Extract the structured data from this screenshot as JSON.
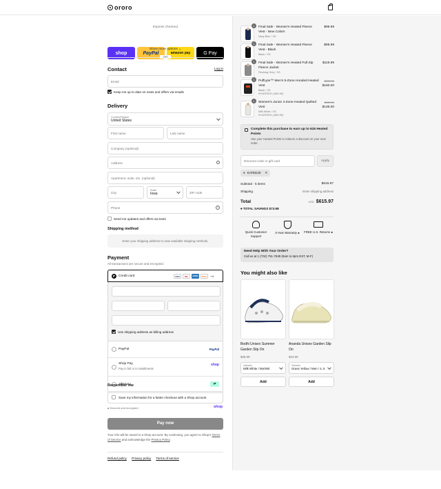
{
  "header": {
    "logo": "ororo",
    "cart_icon": "shopping-bag-icon"
  },
  "express": {
    "title": "Express checkout",
    "buttons": [
      {
        "label": "shop",
        "color": "#5a31f4",
        "text_color": "#ffffff"
      },
      {
        "label": "PayPal",
        "color": "#ffc439",
        "text_color": "#003087"
      },
      {
        "label": "amazon pay",
        "color": "#ffd814",
        "text_color": "#111111"
      },
      {
        "label": "G Pay",
        "color": "#000000",
        "text_color": "#ffffff"
      }
    ],
    "more": "Show more options",
    "or": "OR"
  },
  "contact": {
    "title": "Contact",
    "login": "Log in",
    "email_placeholder": "Email",
    "news_label": "Keep me up to date on news and offers via emails"
  },
  "delivery": {
    "title": "Delivery",
    "country_label": "Country/Region",
    "country_value": "United States",
    "first_name": "First name",
    "last_name": "Last name",
    "company": "Company (optional)",
    "address": "Address",
    "apartment": "Apartment, suite, etc. (optional)",
    "city": "City",
    "state_label": "State",
    "state_value": "Iowa",
    "zip": "ZIP code",
    "phone": "Phone",
    "sms_label": "Send me updates and offers via texts"
  },
  "shipping_method": {
    "title": "Shipping method",
    "note": "Enter your shipping address to view available shipping methods."
  },
  "payment": {
    "title": "Payment",
    "subtitle": "All transactions are secure and encrypted.",
    "credit_card": "Credit card",
    "card_brands": [
      "VISA",
      "MC",
      "AMEX",
      "DISC"
    ],
    "more_cards": "+4",
    "billing_label": "Use shipping address as billing address",
    "paypal": "PayPal",
    "paypal_logo": "PayPal",
    "shoppay": "Shop Pay",
    "shoppay_sub": "Pay in full or in installments",
    "shoppay_logo": "shop",
    "afterpay": "Afterpay"
  },
  "remember": {
    "title": "Remember me",
    "label": "Save my information for a faster checkout with a Shop account",
    "secure": "Secured and encrypted",
    "shop": "shop"
  },
  "pay_now": "Pay now",
  "legal": {
    "text_1": "Your info will be saved to a Shop account. By continuing, you agree to Shop's",
    "terms": "Terms of Service",
    "text_2": "and acknowledge the",
    "privacy": "Privacy Policy",
    "text_3": "."
  },
  "footer_links": [
    "Refund policy",
    "Privacy policy",
    "Terms of service"
  ],
  "cart": {
    "items": [
      {
        "qty": "1",
        "name": "Final Sale - Women's Heated Fleece Vest - New Colors",
        "variant": "Navy Blue / XS",
        "price": "$99.99",
        "tag": ""
      },
      {
        "qty": "1",
        "name": "Final Sale - Women's Heated Fleece Vest - Black",
        "variant": "Black / XS",
        "price": "$99.99",
        "tag": ""
      },
      {
        "qty": "1",
        "name": "Final Sale - Women's Heated Full-Zip Fleece Jacket",
        "variant": "Flecking Grey / XS",
        "price": "$119.99",
        "tag": ""
      },
      {
        "qty": "1",
        "name": "PuffLyte™ Men's 5-Zone Hooded Heated Vest",
        "variant": "Black / XS",
        "old_price": "$199.99",
        "price": "$160.00",
        "tag": "KATEE20 (-$39.99)"
      },
      {
        "qty": "1",
        "name": "Women's Junior 4-Zone Heated Quilted Vest",
        "variant": "Milk White / XS",
        "old_price": "$169.99",
        "price": "$136.00",
        "tag": "KATEE20 (-$33.99)"
      }
    ],
    "points_title": "Complete this purchase to earn up to 615 Heated Points",
    "points_body": "Use your Heated Points to redeem a discount on your next order.",
    "discount_placeholder": "Discount code or gift card",
    "apply": "Apply",
    "code": "KATEE20",
    "subtotal_label": "Subtotal · 5 items",
    "subtotal_value": "$615.97",
    "shipping_label": "Shipping",
    "shipping_value": "Enter shipping address",
    "total_label": "Total",
    "currency": "USD",
    "total_value": "$615.97",
    "savings_label": "TOTAL SAVINGS",
    "savings_value": "$73.98",
    "features": [
      {
        "icon": "headset-icon",
        "label": "Quick Customer Support"
      },
      {
        "icon": "shield-icon",
        "label": "3-Year Warranty"
      },
      {
        "icon": "truck-icon",
        "label": "FREE U.S. Returns"
      }
    ],
    "help_title": "Need Help With Your Order?",
    "help_body": "Call us at 1 (702) 751-7639 (9am to 6pm EST, M-F)",
    "recs_title": "You might also like",
    "recs": [
      {
        "name": "Bodhi Unisex Summer Garden Slip On",
        "price": "$29.99",
        "variant_label": "Variants",
        "variant_value": "Milk White / Mix/Wit",
        "add": "Add"
      },
      {
        "name": "Ananda Unisex Garden Slip On",
        "price": "$24.99",
        "variant_label": "Variants",
        "variant_value": "Grass Yellow / Men / 4..5",
        "add": "Add"
      }
    ]
  }
}
